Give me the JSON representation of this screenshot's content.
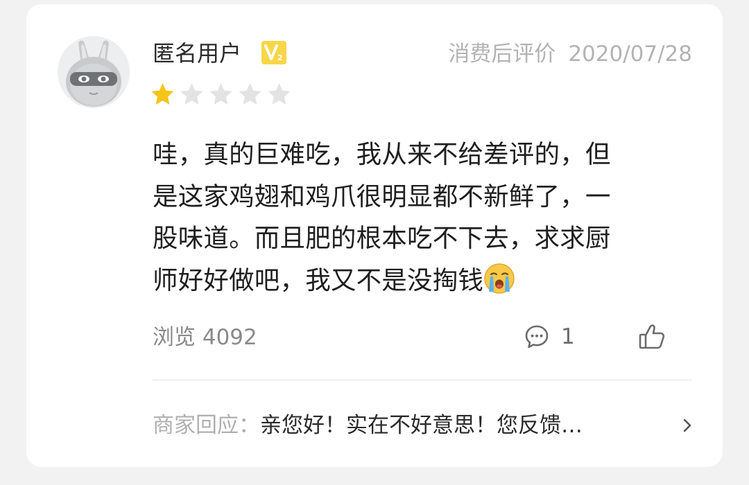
{
  "review": {
    "username": "匿名用户",
    "vip_badge_icon": "vip-level-2-badge",
    "meta_label": "消费后评价",
    "date": "2020/07/28",
    "rating": 1,
    "rating_max": 5,
    "text_lines": [
      "哇，真的巨难吃，我从来不给差评的，但",
      "是这家鸡翅和鸡爪很明显都不新鲜了，一",
      "股味道。而且肥的根本吃不下去，求求厨",
      "师好好做吧，我又不是没掏钱"
    ],
    "emoji": "crying-face-emoji"
  },
  "stats": {
    "views": "浏览 4092",
    "comment_count": "1",
    "comment_icon": "comment-bubble-icon",
    "like_icon": "thumbs-up-icon"
  },
  "merchant_reply": {
    "label": "商家回应：",
    "text": "亲您好！实在不好意思！您反馈…",
    "chevron_icon": "chevron-right-icon"
  },
  "colors": {
    "star_active": "#f5c518",
    "star_inactive": "#e3e3e3",
    "vip_badge": "#f8d648",
    "meta_text": "#b3b3b3"
  }
}
